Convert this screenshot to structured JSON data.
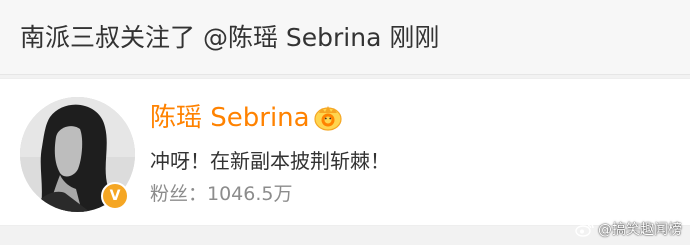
{
  "notice": {
    "text": "南派三叔关注了 @陈瑶 Sebrina 刚刚"
  },
  "user_card": {
    "name": "陈瑶 Sebrina",
    "bio": "冲呀！在新副本披荆斩棘！",
    "fans": "粉丝：1046.5万",
    "verified_badge": "V",
    "avatar_icon": "avatar-portrait",
    "crown_icon": "crown-icon",
    "name_color": "#ff8200",
    "badge_color": "#f5a623"
  },
  "watermark": {
    "text": "@搞笑趣闻榜",
    "icon": "weibo-icon"
  }
}
